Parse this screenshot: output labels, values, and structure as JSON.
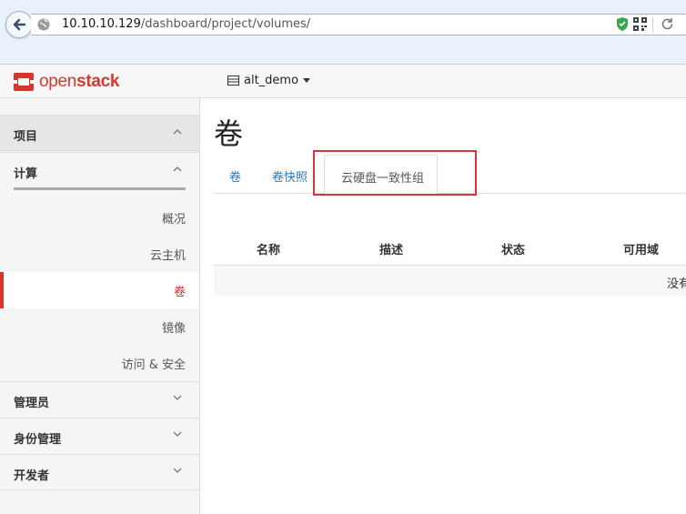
{
  "browser": {
    "url_host": "10.10.10.129",
    "url_path": "/dashboard/project/volumes/"
  },
  "topbar": {
    "logo_text_light": "open",
    "logo_text_bold": "stack",
    "project_name": "alt_demo"
  },
  "sidebar": {
    "project": "项目",
    "compute": "计算",
    "items": [
      {
        "label": "概况"
      },
      {
        "label": "云主机"
      },
      {
        "label": "卷"
      },
      {
        "label": "镜像"
      },
      {
        "label": "访问 & 安全"
      }
    ],
    "admin": "管理员",
    "identity": "身份管理",
    "developer": "开发者"
  },
  "main": {
    "title": "卷",
    "tabs": [
      "卷",
      "卷快照",
      "云硬盘一致性组"
    ],
    "columns": [
      "名称",
      "描述",
      "状态",
      "可用域"
    ],
    "empty_text": "没有"
  },
  "colors": {
    "accent_red": "#d6342c",
    "link_blue": "#2a7ab8"
  }
}
